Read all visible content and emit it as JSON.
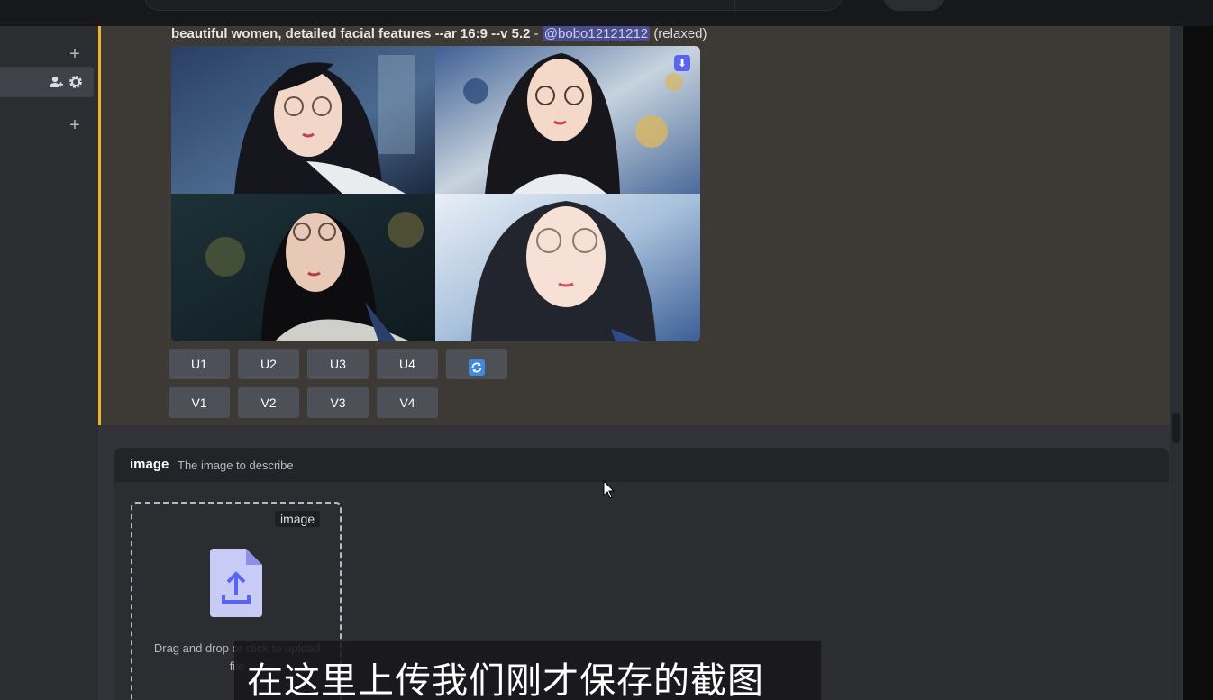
{
  "message": {
    "prompt_text": "beautiful women, detailed facial features --ar 16:9 --v 5.2",
    "separator": " - ",
    "mention": "@bobo12121212",
    "mode": "(relaxed)",
    "images": [
      {
        "label": "image-1",
        "bg": "#2e4a6e"
      },
      {
        "label": "image-2",
        "bg": "#93a9c4"
      },
      {
        "label": "image-3",
        "bg": "#1e2f35"
      },
      {
        "label": "image-4",
        "bg": "#b9cde3"
      }
    ],
    "upscale_buttons": [
      "U1",
      "U2",
      "U3",
      "U4"
    ],
    "variation_buttons": [
      "V1",
      "V2",
      "V3",
      "V4"
    ],
    "refresh_icon": "refresh-icon"
  },
  "sidebar": {
    "icons": [
      "plus-icon",
      "add-member-icon",
      "gear-icon",
      "plus-icon"
    ]
  },
  "option": {
    "name": "image",
    "description": "The image to describe",
    "tag": "image",
    "drop_text": "Drag and drop or click to upload file",
    "icon": "file-upload-icon"
  },
  "subtitle": {
    "text": "在这里上传我们刚才保存的截图"
  },
  "colors": {
    "accent": "#f0b232",
    "button": "#4e5058",
    "blurple": "#5865f2",
    "mention_bg": "#4a4e8a"
  }
}
